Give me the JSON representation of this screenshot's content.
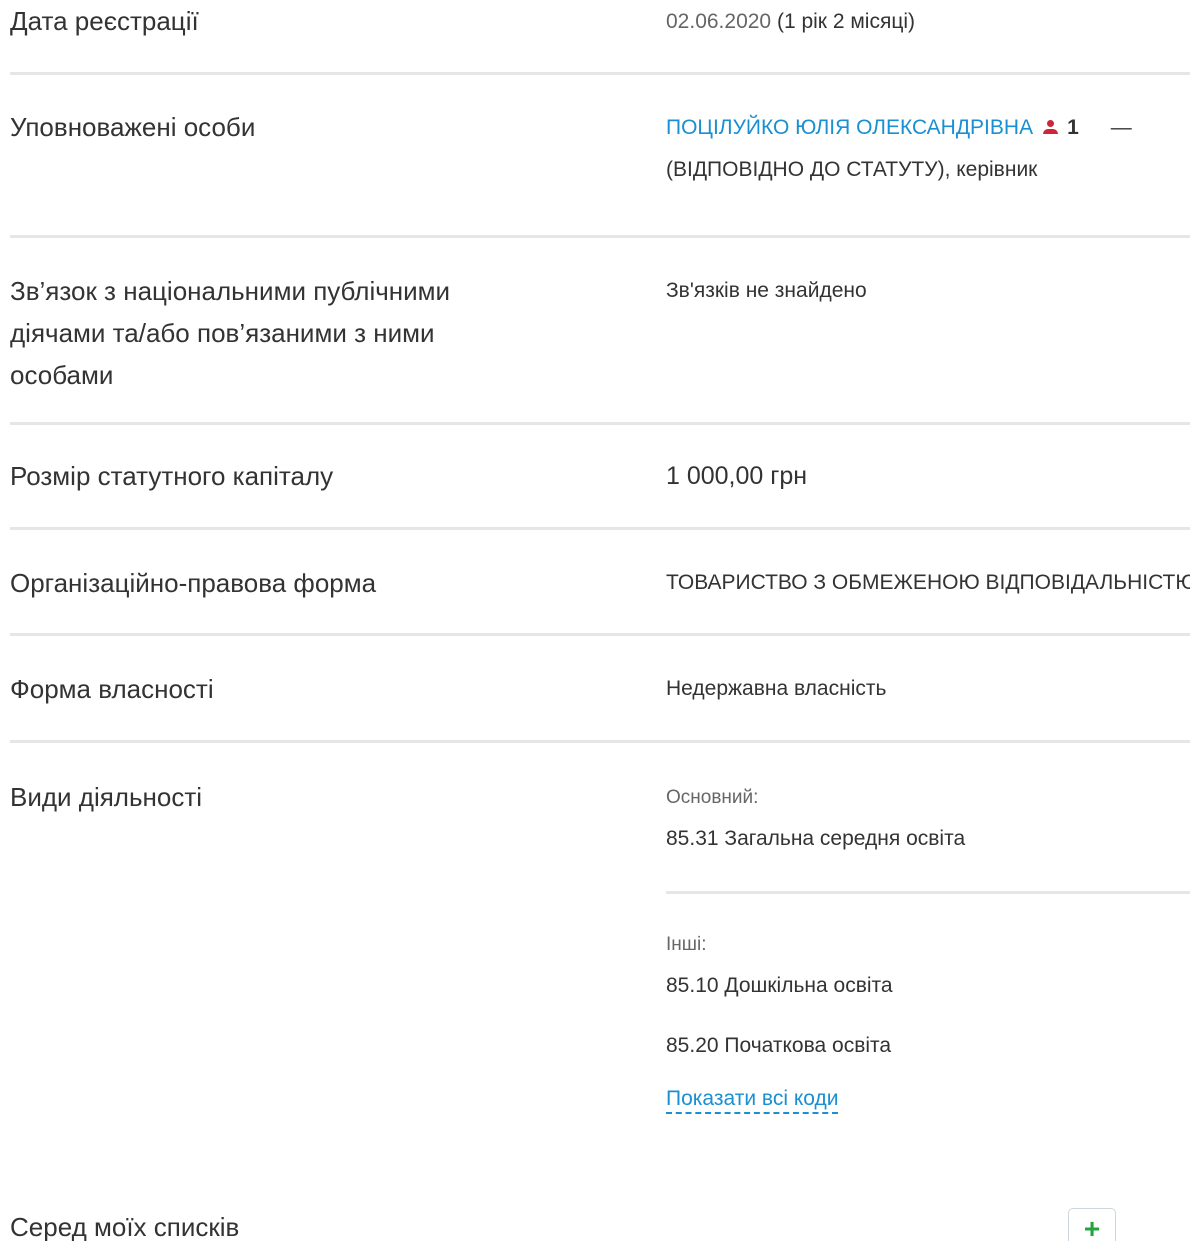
{
  "registration": {
    "label": "Дата реєстрації",
    "date": "02.06.2020",
    "duration": "(1 рік 2 місяці)"
  },
  "authorized": {
    "label": "Уповноважені особи",
    "person_name": "ПОЦІЛУЙКО ЮЛІЯ ОЛЕКСАНДРІВНА",
    "person_count": "1",
    "dash": "—",
    "role_line": "(ВІДПОВІДНО ДО СТАТУТУ), керівник"
  },
  "pep": {
    "label": "Зв’язок з національними публічними\nдіячами та/або пов’язаними з ними\nособами",
    "value": "Зв'язків не знайдено"
  },
  "capital": {
    "label": "Розмір статутного капіталу",
    "value": "1 000,00 грн"
  },
  "legal_form": {
    "label": "Організаційно-правова форма",
    "value": "ТОВАРИСТВО З ОБМЕЖЕНОЮ ВІДПОВІДАЛЬНІСТЮ"
  },
  "ownership": {
    "label": "Форма власності",
    "value": "Недержавна власність"
  },
  "activities": {
    "label": "Види діяльності",
    "main_heading": "Основний:",
    "main_item": "85.31 Загальна середня освіта",
    "other_heading": "Інші:",
    "other_items": [
      "85.10 Дошкільна освіта",
      "85.20 Початкова освіта"
    ],
    "show_all_link": "Показати всі коди"
  },
  "lists": {
    "label": "Серед моїх списків",
    "add_symbol": "+"
  },
  "colors": {
    "link": "#1a8fd1",
    "person_icon": "#d0243b",
    "add_icon": "#22a33c",
    "divider": "#e6e6e6"
  }
}
